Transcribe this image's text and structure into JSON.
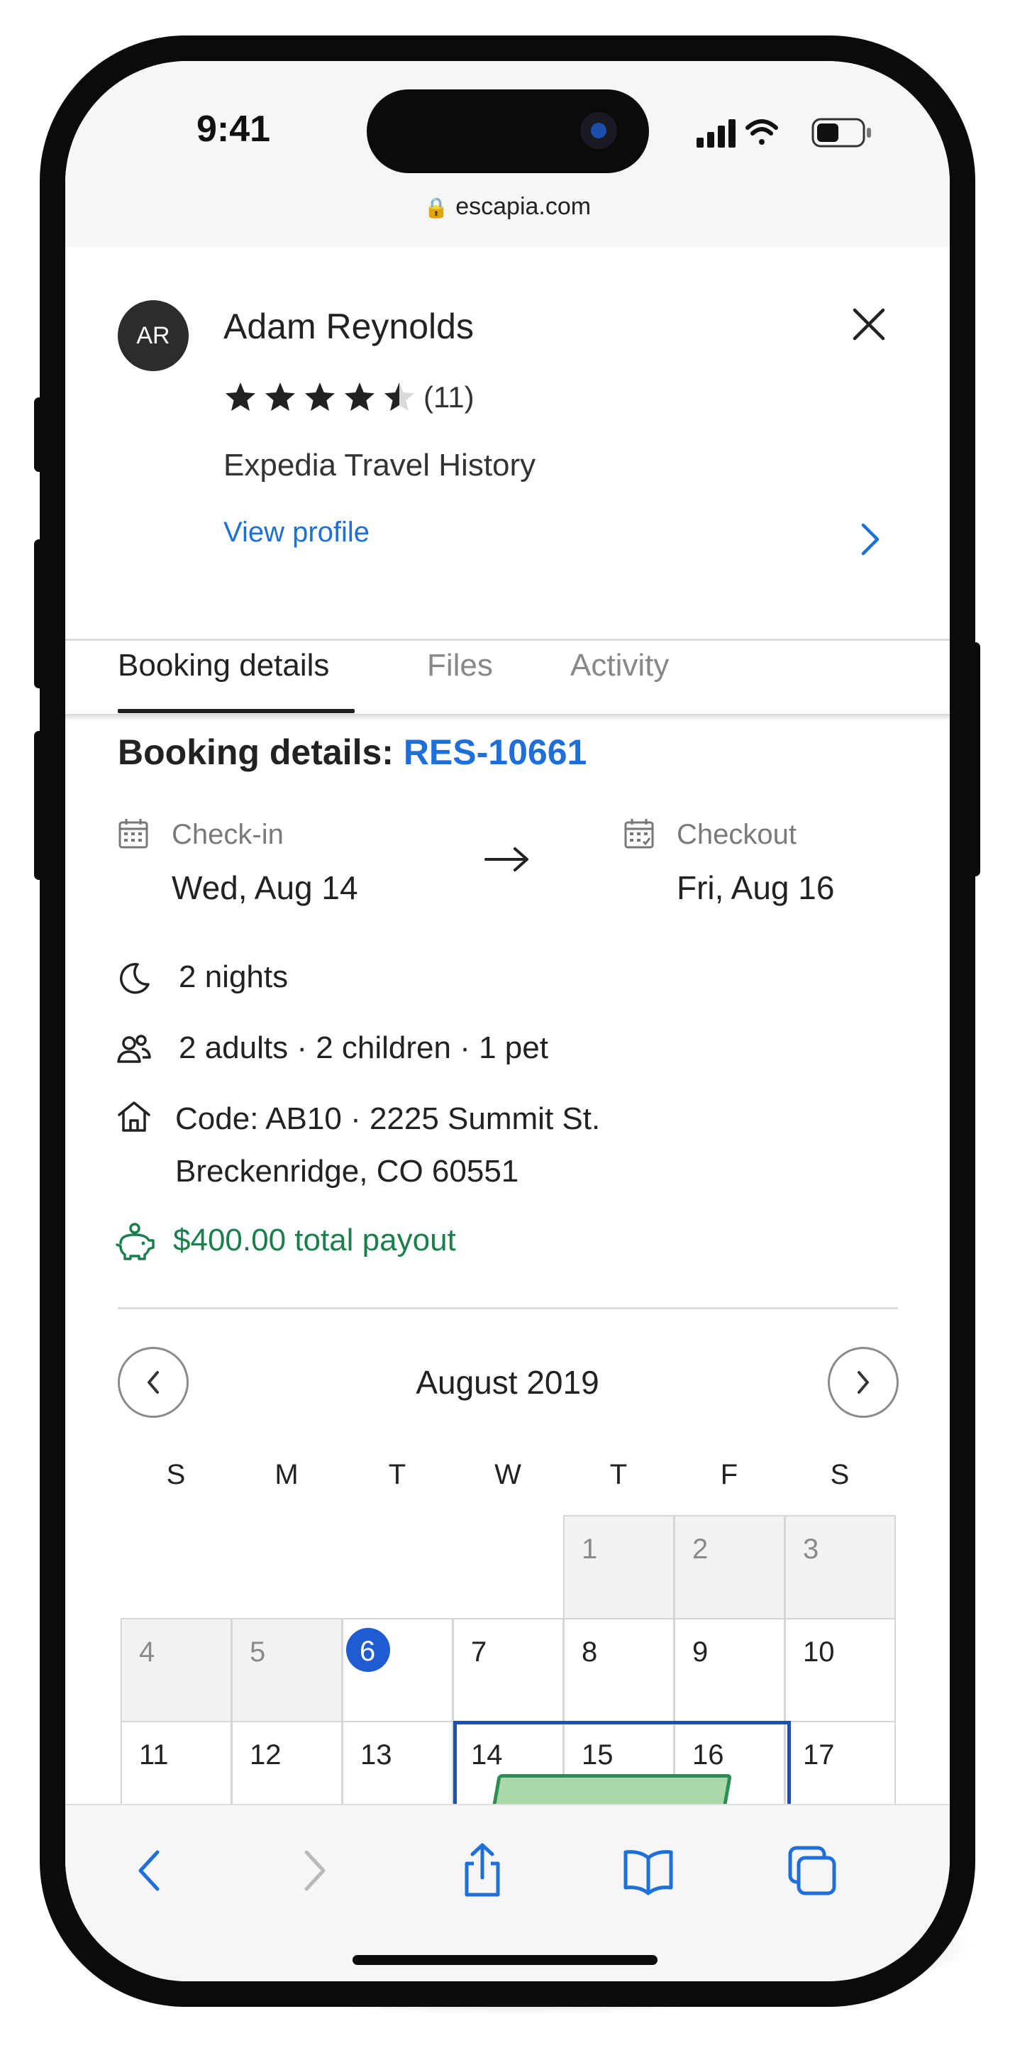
{
  "status_bar": {
    "time": "9:41",
    "url": "escapia.com"
  },
  "guest": {
    "initials": "AR",
    "name": "Adam Reynolds",
    "rating": 4.5,
    "rating_count": "(11)",
    "travel_history": "Expedia Travel History",
    "view_profile": "View profile"
  },
  "tabs": [
    {
      "label": "Booking details",
      "active": true
    },
    {
      "label": "Files",
      "active": false
    },
    {
      "label": "Activity",
      "active": false
    }
  ],
  "booking": {
    "title_prefix": "Booking details: ",
    "id": "RES-10661",
    "checkin_label": "Check-in",
    "checkin_date": "Wed, Aug 14",
    "checkout_label": "Checkout",
    "checkout_date": "Fri, Aug 16",
    "nights": "2 nights",
    "guests": "2 adults · 2 children · 1 pet",
    "address_line1": "Code: AB10 · 2225 Summit St.",
    "address_line2": "Breckenridge, CO 60551",
    "payout": "$400.00 total payout"
  },
  "calendar": {
    "month": "August 2019",
    "weekdays": [
      "S",
      "M",
      "T",
      "W",
      "T",
      "F",
      "S"
    ],
    "weeks": [
      [
        "",
        "",
        "",
        "",
        "1",
        "2",
        "3"
      ],
      [
        "4",
        "5",
        "6",
        "7",
        "8",
        "9",
        "10"
      ],
      [
        "11",
        "12",
        "13",
        "14",
        "15",
        "16",
        "17"
      ]
    ],
    "today": "6",
    "stay_start": "14",
    "stay_end": "16"
  },
  "colors": {
    "link_blue": "#1e6fd9",
    "payout_green": "#1a7f4d",
    "today_blue": "#1f5bd1",
    "stay_border": "#1f4fb0",
    "stay_fill": "#a9d8a9"
  },
  "toolbar": {
    "icons": [
      "back-icon",
      "forward-icon",
      "share-icon",
      "bookmarks-icon",
      "tabs-icon"
    ]
  }
}
